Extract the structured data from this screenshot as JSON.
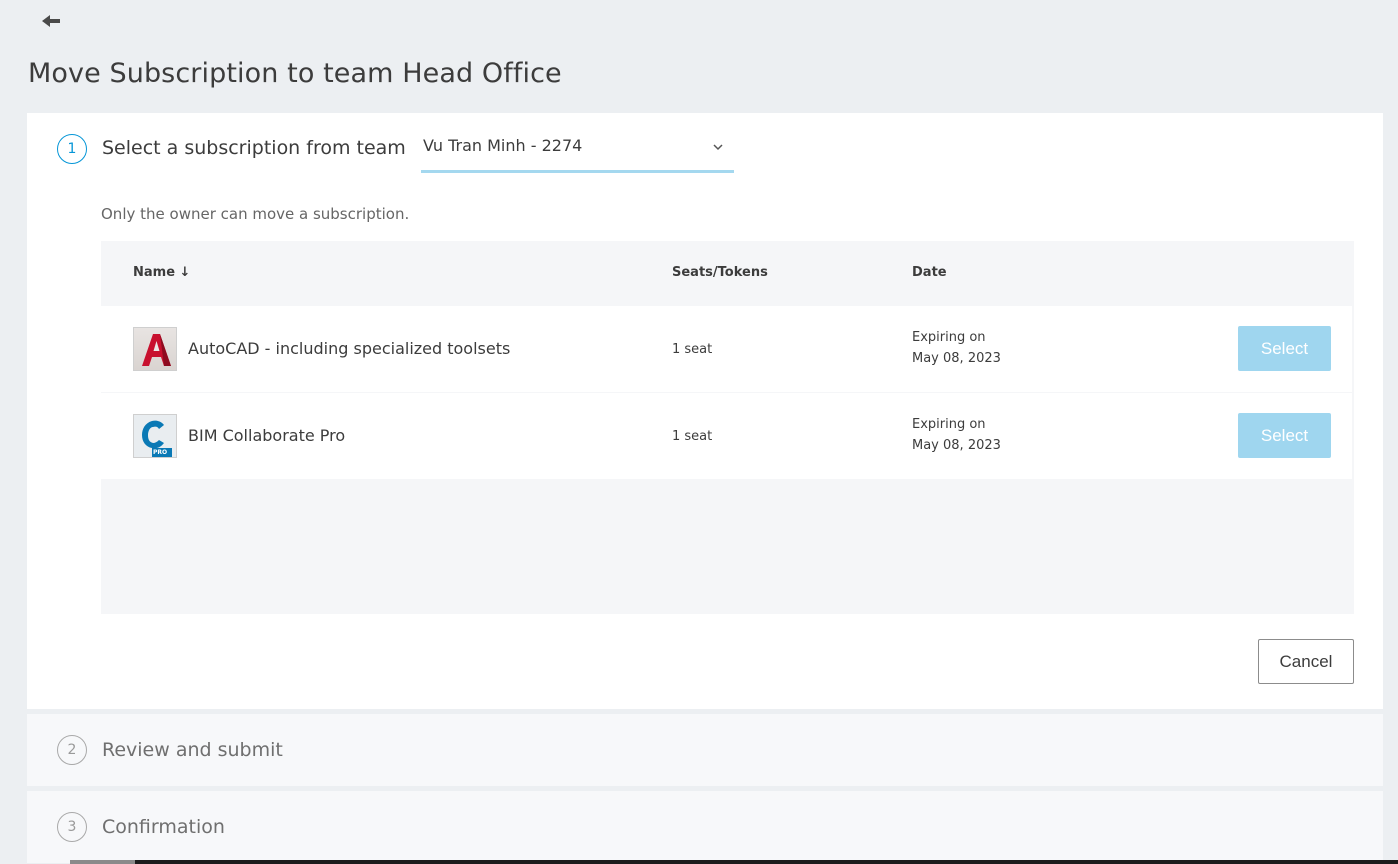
{
  "page": {
    "title": "Move Subscription to team Head Office",
    "back_icon": "arrow-left-icon"
  },
  "steps": [
    {
      "number": "1",
      "label": "Select a subscription from team",
      "state": "active"
    },
    {
      "number": "2",
      "label": "Review and submit",
      "state": "inactive"
    },
    {
      "number": "3",
      "label": "Confirmation",
      "state": "inactive"
    }
  ],
  "team_select": {
    "value": "Vu Tran Minh - 2274",
    "icon": "chevron-down-icon"
  },
  "owner_note": "Only the owner can move a subscription.",
  "table": {
    "columns": {
      "name": "Name ↓",
      "seats": "Seats/Tokens",
      "date": "Date"
    },
    "rows": [
      {
        "name": "AutoCAD - including specialized toolsets",
        "icon": "autocad-product-icon",
        "seats": "1 seat",
        "date_line1": "Expiring on",
        "date_line2": "May 08, 2023",
        "action": "Select"
      },
      {
        "name": "BIM Collaborate Pro",
        "icon": "bim-collaborate-pro-product-icon",
        "icon_badge": "PRO",
        "seats": "1 seat",
        "date_line1": "Expiring on",
        "date_line2": "May 08, 2023",
        "action": "Select"
      }
    ]
  },
  "actions": {
    "cancel": "Cancel"
  },
  "colors": {
    "accent": "#0696d7",
    "select_button_disabled": "#9fd6ef",
    "page_background": "#eceff2"
  }
}
